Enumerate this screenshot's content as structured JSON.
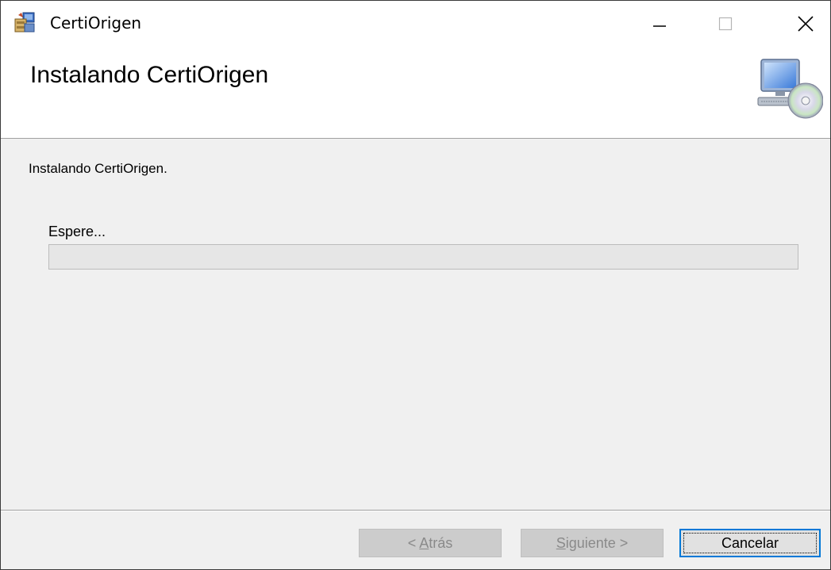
{
  "window": {
    "title": "CertiOrigen",
    "app_icon": "installer-package-icon"
  },
  "caption_buttons": {
    "minimize_icon": "minimize-icon",
    "maximize_icon": "maximize-icon",
    "close_icon": "close-icon"
  },
  "banner": {
    "title": "Instalando CertiOrigen",
    "icon": "computer-cd-icon"
  },
  "body": {
    "status_text": "Instalando CertiOrigen.",
    "wait_label": "Espere...",
    "progress": 0
  },
  "footer": {
    "back_label": "< Atrás",
    "back_mnemonic": "A",
    "next_label": "Siguiente >",
    "next_mnemonic": "S",
    "cancel_label": "Cancelar"
  },
  "colors": {
    "progress_fill": "#06b025",
    "focus_border": "#0078d7"
  }
}
